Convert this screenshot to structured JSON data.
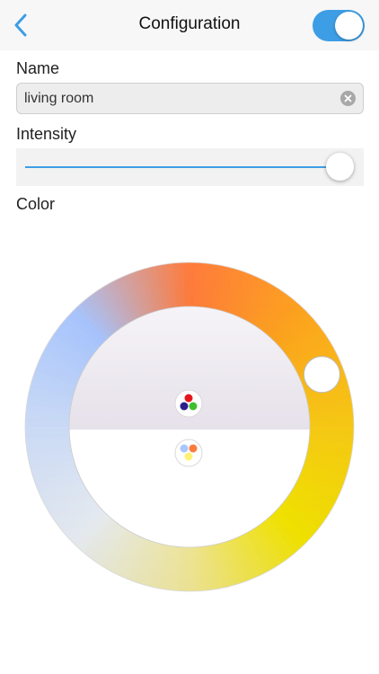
{
  "header": {
    "title": "Configuration",
    "back_icon": "chevron-left-icon",
    "power_toggle_on": true,
    "accent_color": "#3d9ee5"
  },
  "name": {
    "label": "Name",
    "value": "living room",
    "clear_icon": "clear-circle-icon"
  },
  "intensity": {
    "label": "Intensity",
    "value_percent": 100
  },
  "color": {
    "label": "Color",
    "ring_colors": [
      "#ff7b3c",
      "#ffa51e",
      "#ffd015",
      "#fff000",
      "#fff4a0",
      "#f4f9ff",
      "#d2e3ff",
      "#a9c6ff"
    ],
    "picker_position_fraction": 0.19,
    "rgb_palette_icon": "rgb-palette-icon",
    "pastel_palette_icon": "pastel-palette-icon"
  }
}
